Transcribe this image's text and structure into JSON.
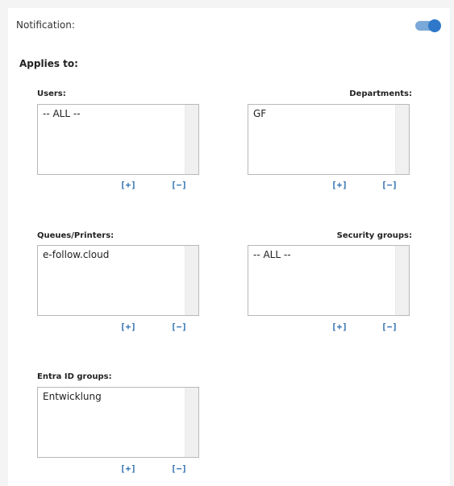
{
  "notification": {
    "label": "Notification:",
    "enabled": true
  },
  "applies_to": {
    "title": "Applies to:"
  },
  "groups": {
    "users": {
      "label": "Users:",
      "items": [
        "-- ALL --"
      ],
      "add": "[+]",
      "remove": "[−]"
    },
    "departments": {
      "label": "Departments:",
      "items": [
        "GF"
      ],
      "add": "[+]",
      "remove": "[−]"
    },
    "queues": {
      "label": "Queues/Printers:",
      "items": [
        "e-follow.cloud"
      ],
      "add": "[+]",
      "remove": "[−]"
    },
    "security": {
      "label": "Security groups:",
      "items": [
        "-- ALL --"
      ],
      "add": "[+]",
      "remove": "[−]"
    },
    "entra": {
      "label": "Entra ID groups:",
      "items": [
        "Entwicklung"
      ],
      "add": "[+]",
      "remove": "[−]"
    }
  },
  "colors": {
    "accent": "#2f78c9",
    "toggle_track": "#7aa8d8",
    "link": "#2f6fb0"
  }
}
